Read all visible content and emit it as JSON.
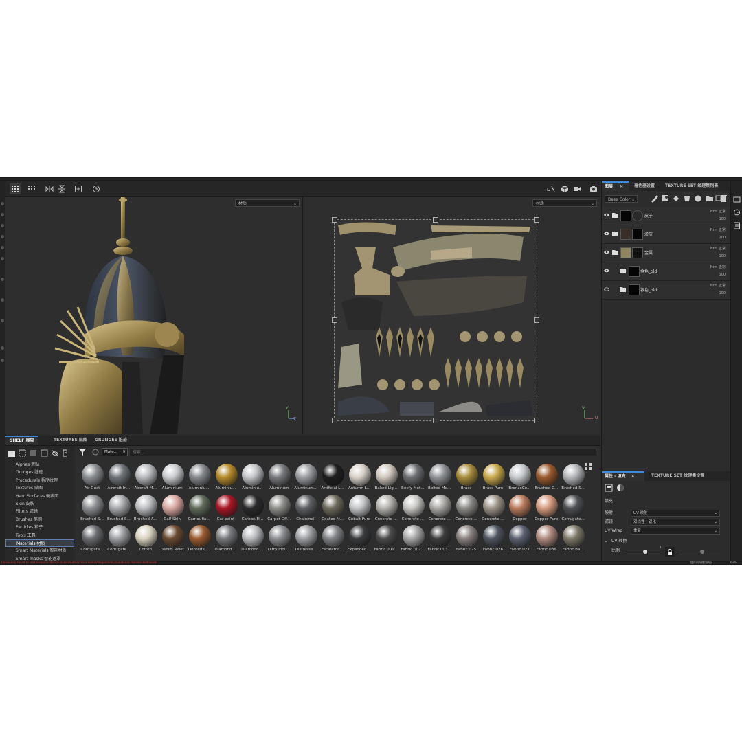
{
  "toolbar": {
    "left_icons": [
      "grid-layout-icon",
      "grid-small-icon",
      "flip-horizontal-icon",
      "flip-vertical-icon",
      "add-frame-icon",
      "reset-view-icon"
    ],
    "right_icons": [
      "view-toggle-icon",
      "cube-icon",
      "camera-video-icon",
      "screenshot-icon"
    ]
  },
  "viewport3d": {
    "dropdown": "材质",
    "axis_y": "Y",
    "axis_z": "Z"
  },
  "viewport2d": {
    "dropdown": "材质",
    "axis_v": "V",
    "axis_u": "U"
  },
  "shelf": {
    "tabs": [
      {
        "label": "SHELF 展架",
        "active": true
      },
      {
        "label": "TEXTURES 贴图",
        "active": false
      },
      {
        "label": "GRUNGES 脏迹",
        "active": false
      }
    ],
    "filter_chip": "Mate…",
    "search_placeholder": "搜索...",
    "categories": [
      {
        "label": "Alphas 遮贴"
      },
      {
        "label": "Grunges 脏迹"
      },
      {
        "label": "Procedurals 程序纹理"
      },
      {
        "label": "Textures 贴图"
      },
      {
        "label": "Hard Surfaces 硬表面"
      },
      {
        "label": "Skin 皮肤"
      },
      {
        "label": "Filters 滤镜"
      },
      {
        "label": "Brushes 笔刷"
      },
      {
        "label": "Particles 粒子"
      },
      {
        "label": "Tools 工具"
      },
      {
        "label": "Materials 材质",
        "selected": true
      },
      {
        "label": "Smart Materials 智能材质"
      },
      {
        "label": "Smart masks 智能遮罩"
      }
    ],
    "materials": [
      {
        "label": "Air Duct",
        "color": "#8a8d90"
      },
      {
        "label": "Aircraft In...",
        "color": "#6f7378"
      },
      {
        "label": "Aircraft M...",
        "color": "#b8babd"
      },
      {
        "label": "Aluminium",
        "color": "#c9cbce"
      },
      {
        "label": "Aluminiu...",
        "color": "#85888c"
      },
      {
        "label": "Aluminiu...",
        "color": "#b58a2a"
      },
      {
        "label": "Aluminiu...",
        "color": "#c2c4c7"
      },
      {
        "label": "Aluminum",
        "color": "#77797c"
      },
      {
        "label": "Aluminum...",
        "color": "#9a9ca0"
      },
      {
        "label": "Artificial L...",
        "color": "#1e1e1e"
      },
      {
        "label": "Autumn L...",
        "color": "#d7d0c8"
      },
      {
        "label": "Baked Lig...",
        "color": "#cfc7bd"
      },
      {
        "label": "Beefy Met...",
        "color": "#6b6d70"
      },
      {
        "label": "Bolted Me...",
        "color": "#8f9296"
      },
      {
        "label": "Brass",
        "color": "#a88c3c"
      },
      {
        "label": "Brass Pure",
        "color": "#c7a84c"
      },
      {
        "label": "BronzeCo...",
        "color": "#c6c9cc"
      },
      {
        "label": "Brushed C...",
        "color": "#9a5a2e"
      },
      {
        "label": "Brushed S...",
        "color": "#b4b6b9"
      },
      {
        "label": "Brushed S...",
        "color": "#8c8e91"
      },
      {
        "label": "Brushed S...",
        "color": "#a7a9ac"
      },
      {
        "label": "Brushed A...",
        "color": "#bcbec1"
      },
      {
        "label": "Calf Skin",
        "color": "#d9a7a0"
      },
      {
        "label": "Camoufla...",
        "color": "#5f6a5a"
      },
      {
        "label": "Car paint",
        "color": "#a81624"
      },
      {
        "label": "Carbon Fi...",
        "color": "#2a2a2c"
      },
      {
        "label": "Carpet Off...",
        "color": "#8d8e8a"
      },
      {
        "label": "Chainmail",
        "color": "#5d5f62"
      },
      {
        "label": "Coated M...",
        "color": "#6d6a5c"
      },
      {
        "label": "Cobalt Pure",
        "color": "#c3c4c6"
      },
      {
        "label": "Concrete ...",
        "color": "#b3b2ae"
      },
      {
        "label": "Concrete ...",
        "color": "#c8c7c4"
      },
      {
        "label": "Concrete ...",
        "color": "#a9a8a5"
      },
      {
        "label": "Concrete ...",
        "color": "#8c8b88"
      },
      {
        "label": "Concrete ...",
        "color": "#9b9287"
      },
      {
        "label": "Copper",
        "color": "#b87a5c"
      },
      {
        "label": "Copper Pure",
        "color": "#d49a7e"
      },
      {
        "label": "Corrugate...",
        "color": "#4d4f52"
      },
      {
        "label": "Corrugate...",
        "color": "#6a6c6f"
      },
      {
        "label": "Corrugate...",
        "color": "#9c9ea1"
      },
      {
        "label": "Cotton",
        "color": "#d8d2bf"
      },
      {
        "label": "Denim Rivet",
        "color": "#6a4a32"
      },
      {
        "label": "Dented C...",
        "color": "#9a5a30"
      },
      {
        "label": "Diamond ...",
        "color": "#77797c"
      },
      {
        "label": "Diamond ...",
        "color": "#b9bbbe"
      },
      {
        "label": "Dirty Indu...",
        "color": "#8c8e91"
      },
      {
        "label": "Distresse...",
        "color": "#9ea0a3"
      },
      {
        "label": "Escalator ...",
        "color": "#808285"
      },
      {
        "label": "Expanded ...",
        "color": "#3a3b3d"
      },
      {
        "label": "Fabric 001...",
        "color": "#4a4a4a"
      },
      {
        "label": "Fabric 002...",
        "color": "#a6a6a6"
      },
      {
        "label": "Fabric 003...",
        "color": "#3d3d3d"
      },
      {
        "label": "Fabric 025",
        "color": "#8a8080"
      },
      {
        "label": "Fabric 026",
        "color": "#4f5560"
      },
      {
        "label": "Fabric 027",
        "color": "#5c6070"
      },
      {
        "label": "Fabric 036",
        "color": "#b08a80"
      },
      {
        "label": "Fabric Ba...",
        "color": "#7e7868"
      }
    ]
  },
  "layers_panel": {
    "tabs": [
      {
        "label": "图层",
        "active": true
      },
      {
        "label": "着色器设置",
        "active": false
      },
      {
        "label": "TEXTURE SET 纹理集列表",
        "active": false
      }
    ],
    "channel": "Base Color",
    "layers": [
      {
        "name": "皮子",
        "blend": "Nrm 正常",
        "opacity": "100",
        "visible": true
      },
      {
        "name": "漆皮",
        "blend": "Nrm 正常",
        "opacity": "100",
        "visible": true
      },
      {
        "name": "金属",
        "blend": "Nrm 正常",
        "opacity": "100",
        "visible": true
      },
      {
        "name": "金色_old",
        "blend": "Nrm 正常",
        "opacity": "100",
        "visible": true
      },
      {
        "name": "银色_old",
        "blend": "Nrm 正常",
        "opacity": "100",
        "visible": false
      }
    ]
  },
  "properties_panel": {
    "tabs": [
      {
        "label": "属性 - 填充",
        "active": true
      },
      {
        "label": "TEXTURE SET 纹理集设置",
        "active": false
      }
    ],
    "section": "填充",
    "rows": [
      {
        "label": "映射",
        "value": "UV 映射"
      },
      {
        "label": "滤镜",
        "value": "双线性 | 锐化"
      },
      {
        "label": "UV Wrap",
        "value": "重复"
      }
    ],
    "uv_section": "UV 转换",
    "scale_label": "比例",
    "scale_value": "1"
  },
  "status": {
    "error_text": "[Resource] Failed to load resource: file:///E:/Users/Admin/Documents/Allegorithmic/Substance Painter/shelf/assets",
    "right_text": "缓存内存使用情况",
    "percent": "63%"
  },
  "colors": {
    "accent": "#3d8bd8",
    "panel": "#2c2c2c",
    "dark": "#1e1e1e"
  }
}
